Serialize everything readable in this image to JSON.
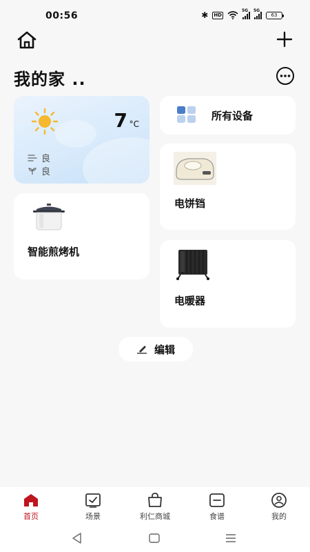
{
  "status_bar": {
    "time": "00:56",
    "hd": "HD",
    "signal1": "5G",
    "signal2": "5G",
    "battery": "63"
  },
  "header": {
    "home_title": "我的家 .."
  },
  "weather": {
    "temperature": "7",
    "unit": "°C",
    "air_quality_label": "良",
    "humidity_label": "良"
  },
  "all_devices": {
    "label": "所有设备"
  },
  "devices": [
    {
      "name": "智能煎烤机",
      "icon": "pressure-cooker-icon"
    },
    {
      "name": "电饼铛",
      "icon": "electric-griddle-icon"
    },
    {
      "name": "电暖器",
      "icon": "oil-heater-icon"
    }
  ],
  "edit": {
    "label": "编辑"
  },
  "bottom_nav": [
    {
      "label": "首页",
      "active": true
    },
    {
      "label": "场景",
      "active": false
    },
    {
      "label": "利仁商城",
      "active": false
    },
    {
      "label": "食谱",
      "active": false
    },
    {
      "label": "我的",
      "active": false
    }
  ],
  "colors": {
    "accent": "#c0141e",
    "background": "#f7f7f7",
    "sun": "#f5b82e",
    "grid_blue": "#4a7cc9"
  }
}
